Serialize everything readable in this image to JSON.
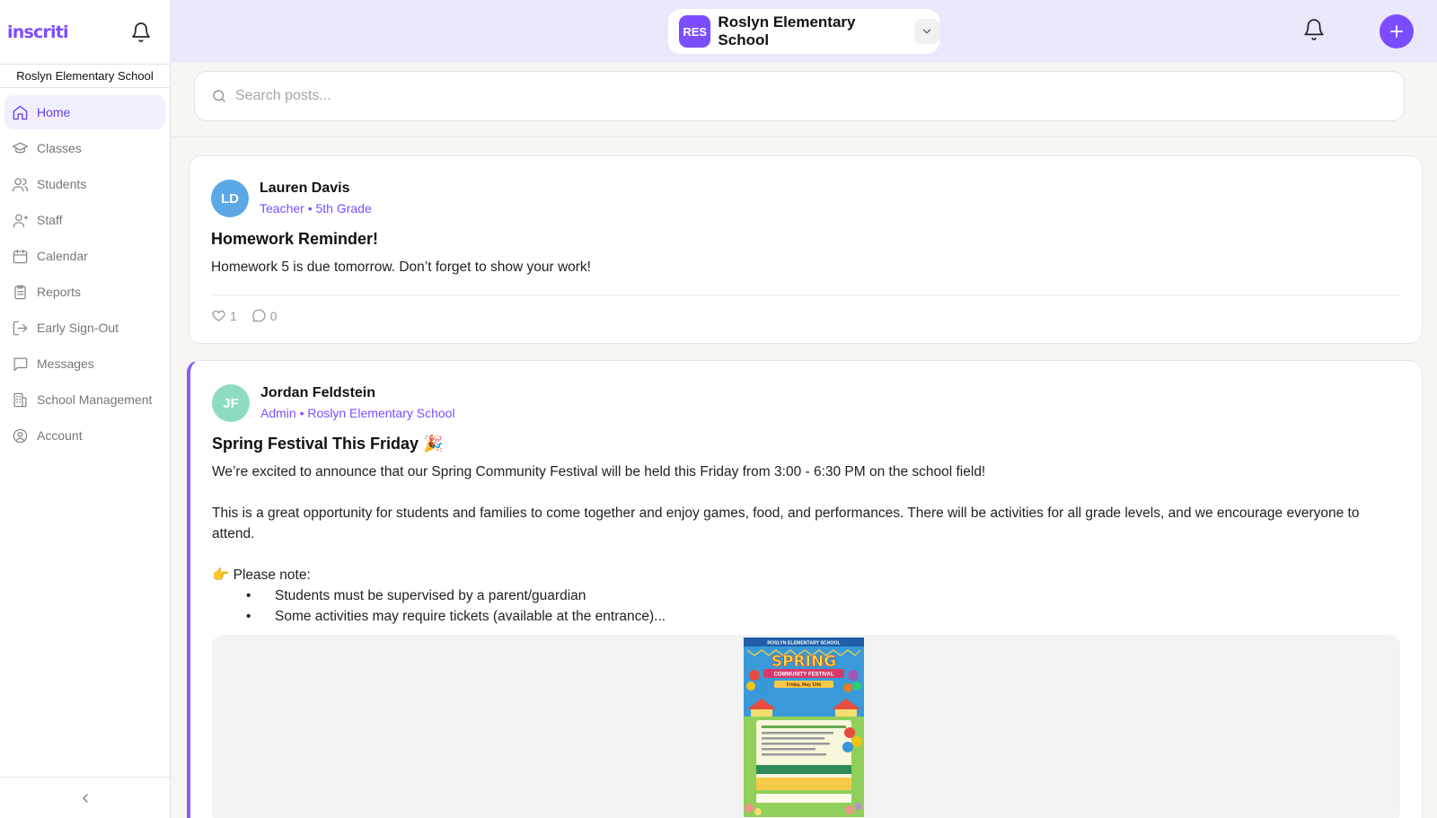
{
  "app": {
    "logo": "inscriti",
    "school_name": "Roslyn Elementary School"
  },
  "sidebar": {
    "items": [
      {
        "label": "Home"
      },
      {
        "label": "Classes"
      },
      {
        "label": "Students"
      },
      {
        "label": "Staff"
      },
      {
        "label": "Calendar"
      },
      {
        "label": "Reports"
      },
      {
        "label": "Early Sign-Out"
      },
      {
        "label": "Messages"
      },
      {
        "label": "School Management"
      },
      {
        "label": "Account"
      }
    ]
  },
  "header": {
    "school_badge": "RES",
    "school_name": "Roslyn Elementary School"
  },
  "search": {
    "placeholder": "Search posts..."
  },
  "posts": [
    {
      "avatar": "LD",
      "author": "Lauren Davis",
      "role": "Teacher • 5th Grade",
      "title": "Homework Reminder!",
      "body": "Homework 5 is due tomorrow. Don’t forget to show your work!",
      "likes": "1",
      "comments": "0"
    },
    {
      "avatar": "JF",
      "author": "Jordan Feldstein",
      "role": "Admin • Roslyn Elementary School",
      "title": "Spring Festival This Friday 🎉",
      "paragraph1": "We’re excited to announce that our Spring Community Festival will be held this Friday from 3:00 - 6:30 PM on the school field!",
      "paragraph2": "This is a great opportunity for students and families to come together and enjoy games, food, and performances. There will be activities for all grade levels, and we encourage everyone to attend.",
      "note_heading": "👉 Please note:",
      "bullets": [
        "Students must be supervised by a parent/guardian",
        "Some activities may require tickets (available at the entrance)..."
      ],
      "poster": {
        "school": "ROSLYN ELEMENTARY SCHOOL",
        "headline": "SPRING",
        "subhead": "COMMUNITY FESTIVAL",
        "date": "Friday, May 10th"
      }
    }
  ],
  "colors": {
    "accent": "#7c4dff",
    "header_bg": "#ece8fc",
    "active_nav_bg": "#f1effc"
  }
}
